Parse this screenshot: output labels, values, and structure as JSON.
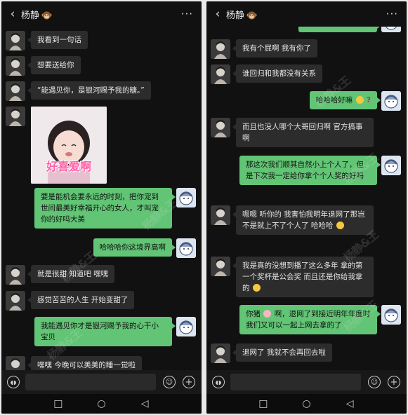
{
  "left": {
    "header": {
      "back": "‹",
      "title": "杨静",
      "more": "···"
    },
    "messages": [
      {
        "id": "l1",
        "text": "我看到一句话"
      },
      {
        "id": "l2",
        "text": "想要送给你"
      },
      {
        "id": "l3",
        "text": "“能遇见你，是银河赐予我的糖。”"
      },
      {
        "id": "l4",
        "sticker_text": "好喜爱啊"
      },
      {
        "id": "l5",
        "text": "要是能机会要永远的时刻，把你宠到世间最美好幸福开心的女人，才叫宠你的好吗大美"
      },
      {
        "id": "l6",
        "text": "哈哈哈你这境界高啊"
      },
      {
        "id": "l7",
        "text": "就是很甜 知道吧 嘿嘿"
      },
      {
        "id": "l8",
        "text": "感觉苦苦的人生 开始变甜了"
      },
      {
        "id": "l9",
        "text": "我能遇见你才是银河赐予我的心干小宝贝"
      },
      {
        "id": "l10",
        "text": "嘿嘿 今晚可以美美的睡一觉啦"
      }
    ],
    "nav": {
      "recent": "□",
      "home": "○",
      "back": "◁"
    }
  },
  "right": {
    "header": {
      "back": "‹",
      "title": "杨静",
      "more": "···"
    },
    "messages": [
      {
        "id": "r1",
        "text": "我有个屁啊 我有你了"
      },
      {
        "id": "r2",
        "text": "谁回归和我都没有关系"
      },
      {
        "id": "r3",
        "text": "哈哈哈好嘛"
      },
      {
        "id": "r4",
        "text": "而且也没人哪个大哥回归啊 官方搞事啊"
      },
      {
        "id": "r5",
        "text": "那这次我们顺其自然小上个人了，但是下次我一定给你拿个个人奖的好吗"
      },
      {
        "id": "r6",
        "text": "嗯嗯 听你的 我害怕我明年退网了那岂不是就上不了个人了 哈哈哈"
      },
      {
        "id": "r7",
        "text": "我是真的没想到播了这么多年 拿的第一个奖杯是公会奖 而且还是你给我拿的"
      },
      {
        "id": "r8a",
        "text": "你猪"
      },
      {
        "id": "r8b",
        "text": "啊，退网了到接近明年年度时我们又可以一起上网去拿的了"
      },
      {
        "id": "r9",
        "text": "退网了 我就不会再回去啦"
      }
    ],
    "nav": {
      "recent": "□",
      "home": "○",
      "back": "◁"
    }
  },
  "input": {
    "placeholder": ""
  },
  "watermark": "杨静&王"
}
